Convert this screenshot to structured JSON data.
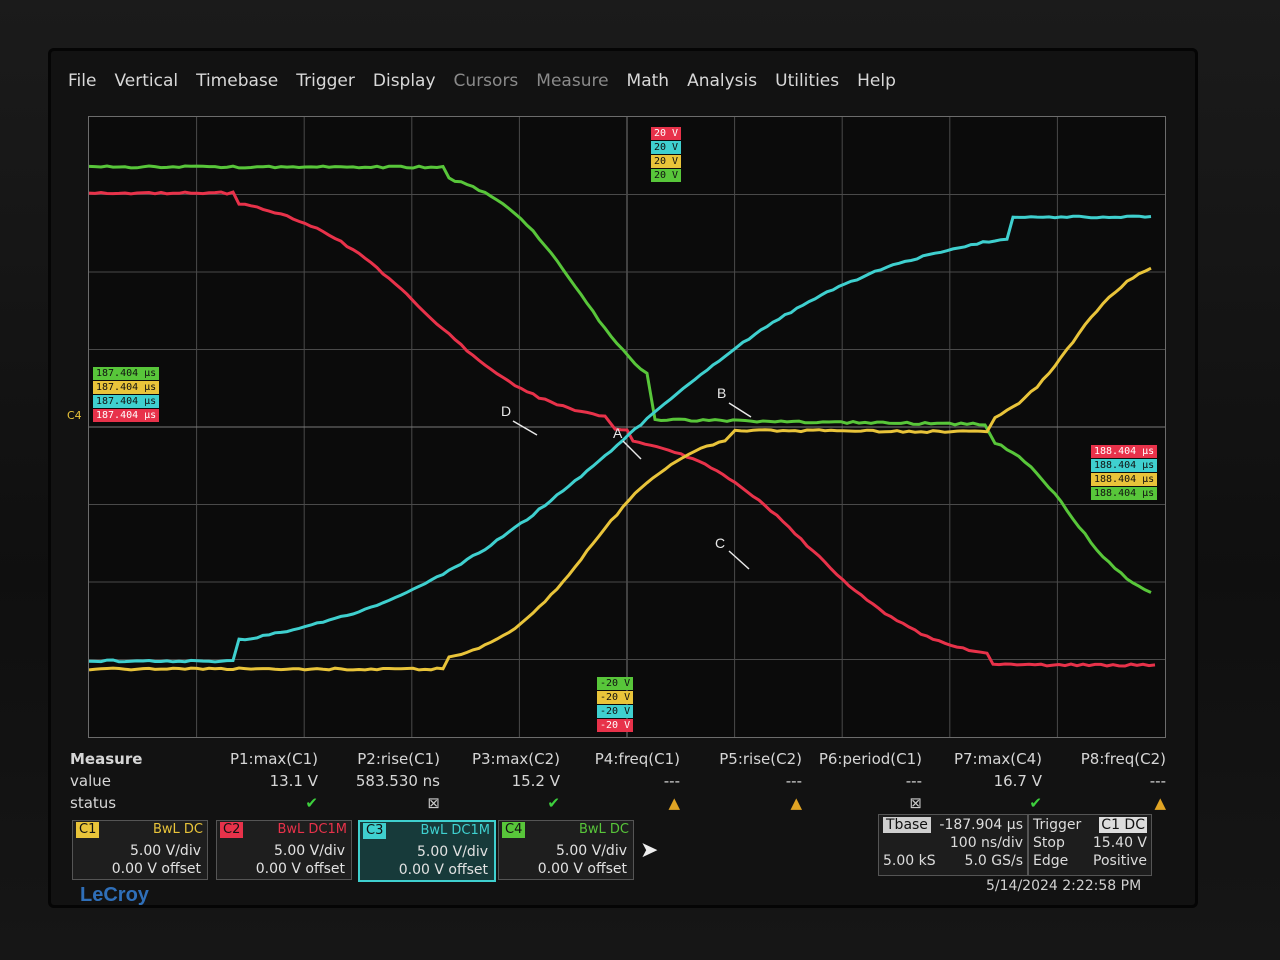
{
  "menu": [
    {
      "label": "File",
      "dim": false
    },
    {
      "label": "Vertical",
      "dim": false
    },
    {
      "label": "Timebase",
      "dim": false
    },
    {
      "label": "Trigger",
      "dim": false
    },
    {
      "label": "Display",
      "dim": false
    },
    {
      "label": "Cursors",
      "dim": true
    },
    {
      "label": "Measure",
      "dim": true
    },
    {
      "label": "Math",
      "dim": false
    },
    {
      "label": "Analysis",
      "dim": false
    },
    {
      "label": "Utilities",
      "dim": false
    },
    {
      "label": "Help",
      "dim": false
    }
  ],
  "scale_tags_top": [
    "20 V",
    "20 V",
    "20 V",
    "20 V"
  ],
  "scale_tags_bottom": [
    "-20 V",
    "-20 V",
    "-20 V",
    "-20 V"
  ],
  "time_tags_left": [
    "187.404 µs",
    "187.404 µs",
    "187.404 µs",
    "187.404 µs"
  ],
  "time_tags_right": [
    "188.404 µs",
    "188.404 µs",
    "188.404 µs",
    "188.404 µs"
  ],
  "cursor_letters": [
    "D",
    "B",
    "A",
    "C"
  ],
  "ch_marker": "C4",
  "measure": {
    "labels": {
      "row1": "Measure",
      "row2": "value",
      "row3": "status"
    },
    "params": [
      {
        "name": "P1:max(C1)",
        "value": "13.1 V",
        "status": "ok"
      },
      {
        "name": "P2:rise(C1)",
        "value": "583.530 ns",
        "status": "x"
      },
      {
        "name": "P3:max(C2)",
        "value": "15.2 V",
        "status": "ok"
      },
      {
        "name": "P4:freq(C1)",
        "value": "---",
        "status": "warn"
      },
      {
        "name": "P5:rise(C2)",
        "value": "---",
        "status": "warn"
      },
      {
        "name": "P6:period(C1)",
        "value": "---",
        "status": "x"
      },
      {
        "name": "P7:max(C4)",
        "value": "16.7 V",
        "status": "ok"
      },
      {
        "name": "P8:freq(C2)",
        "value": "---",
        "status": "warn"
      }
    ]
  },
  "channels": [
    {
      "name": "C1",
      "coupling": "BwL DC",
      "vdiv": "5.00 V/div",
      "offset": "0.00 V offset",
      "color": "#e9c43a"
    },
    {
      "name": "C2",
      "coupling": "BwL DC1M",
      "vdiv": "5.00 V/div",
      "offset": "0.00 V offset",
      "color": "#e8324a"
    },
    {
      "name": "C3",
      "coupling": "BwL DC1M",
      "vdiv": "5.00 V/div",
      "offset": "0.00 V offset",
      "color": "#3fd0cf"
    },
    {
      "name": "C4",
      "coupling": "BwL DC",
      "vdiv": "5.00 V/div",
      "offset": "0.00 V offset",
      "color": "#58c63a"
    }
  ],
  "timebase": {
    "label": "Tbase",
    "delay": "-187.904 µs",
    "per_div": "100 ns/div",
    "samples": "5.00 kS",
    "rate": "5.0 GS/s"
  },
  "trigger": {
    "label": "Trigger",
    "source": "C1 DC",
    "mode": "Stop",
    "level": "15.40 V",
    "type": "Edge",
    "slope": "Positive"
  },
  "datetime": "5/14/2024 2:22:58 PM",
  "logo": "LeCroy",
  "trace_colors": {
    "red": "#e8324a",
    "cyan": "#3fd0cf",
    "yellow": "#e9c43a",
    "green": "#58c63a"
  }
}
